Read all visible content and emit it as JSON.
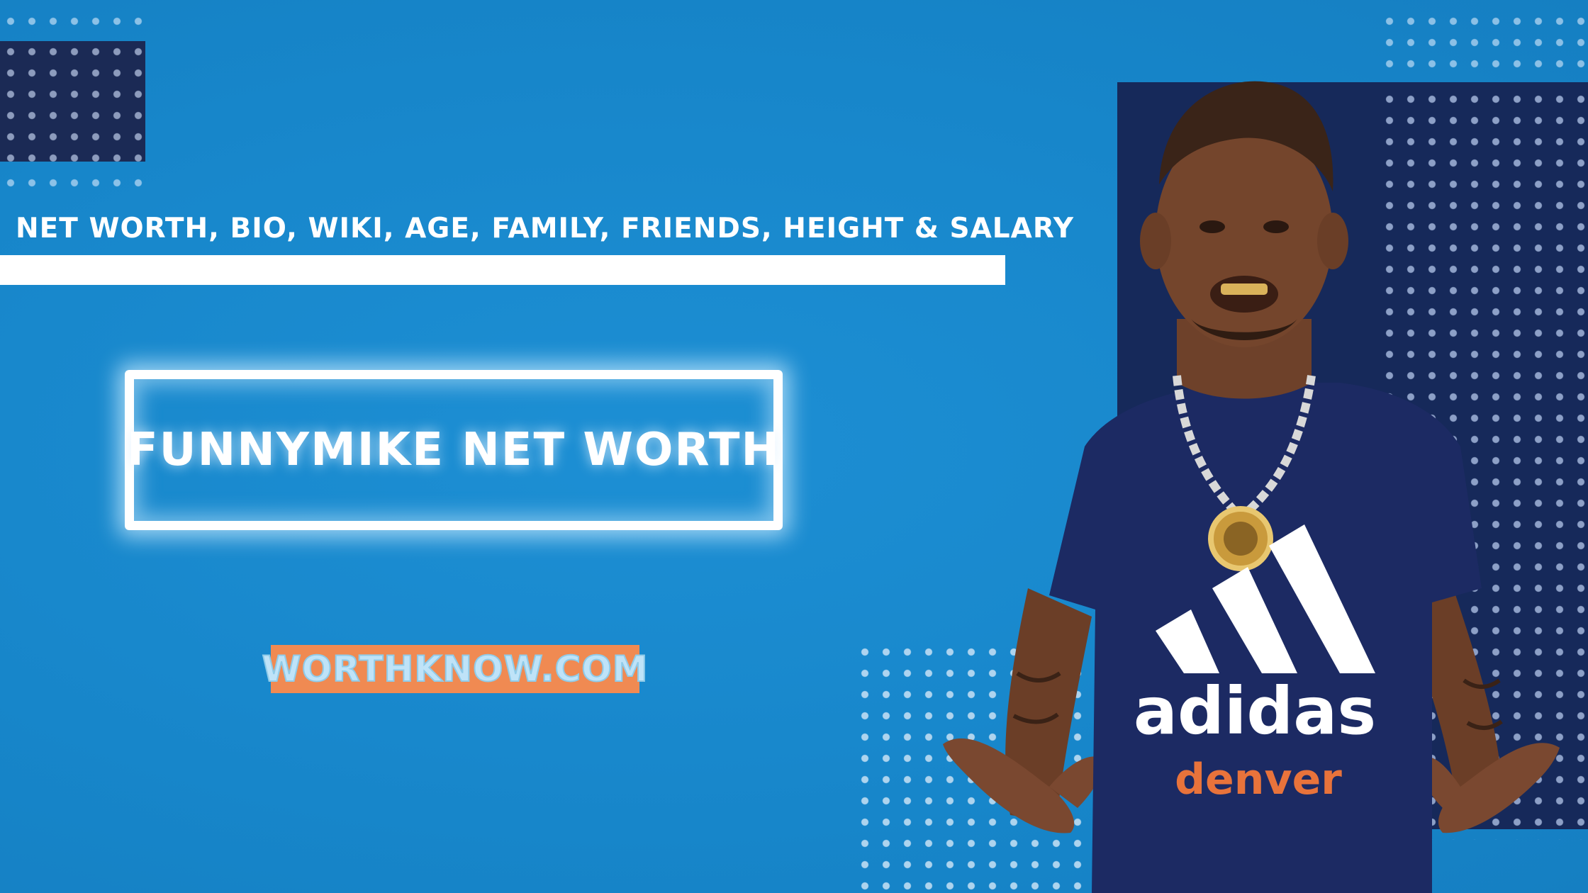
{
  "tagline": "NET WORTH, BIO, WIKI, AGE, FAMILY, FRIENDS, HEIGHT & SALARY",
  "title": "FUNNYMIKE NET WORTH",
  "site": "WORTHKNOW.COM",
  "shirt": {
    "brand": "adidas",
    "city": "denver"
  },
  "colors": {
    "background": "#1888cc",
    "panel": "#16295a",
    "accent_badge": "#f08a52",
    "shirt": "#1c2a63"
  }
}
